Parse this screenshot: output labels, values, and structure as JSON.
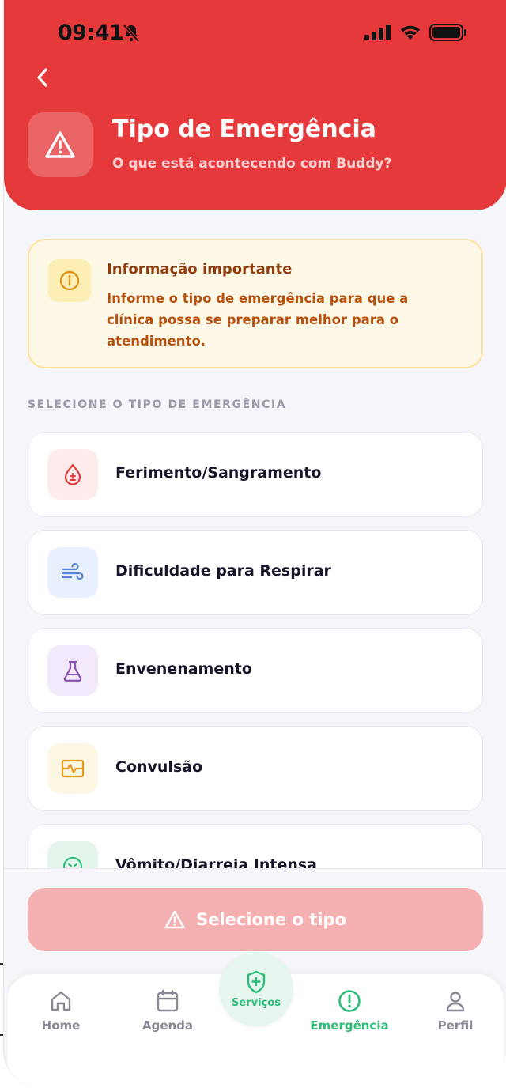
{
  "status_bar": {
    "time": "09:41"
  },
  "header": {
    "title": "Tipo de Emergência",
    "subtitle": "O que está acontecendo com Buddy?"
  },
  "info": {
    "title": "Informação importante",
    "text": "Informe o tipo de emergência para que a clínica possa se preparar melhor para o atendimento."
  },
  "section_label": "SELECIONE O TIPO DE EMERGÊNCIA",
  "options": [
    {
      "label": "Ferimento/Sangramento",
      "icon": "blood-drop-icon",
      "color": "#e5393c",
      "bg": "#fdeceb"
    },
    {
      "label": "Dificuldade para Respirar",
      "icon": "wind-icon",
      "color": "#5b86d6",
      "bg": "#e8effd"
    },
    {
      "label": "Envenenamento",
      "icon": "flask-icon",
      "color": "#8a4fb8",
      "bg": "#f2eafa"
    },
    {
      "label": "Convulsão",
      "icon": "pulse-icon",
      "color": "#e49a1c",
      "bg": "#fdf6e3"
    },
    {
      "label": "Vômito/Diarreia Intensa",
      "icon": "sick-face-icon",
      "color": "#2ebd79",
      "bg": "#e4f6ec"
    }
  ],
  "cta": {
    "label": "Selecione o tipo"
  },
  "tabs": {
    "home": "Home",
    "agenda": "Agenda",
    "servicos": "Serviços",
    "emergencia": "Emergência",
    "perfil": "Perfil"
  },
  "colors": {
    "primary": "#e5393c",
    "accent": "#2ebd79",
    "cta_disabled": "#f5b1b1"
  }
}
